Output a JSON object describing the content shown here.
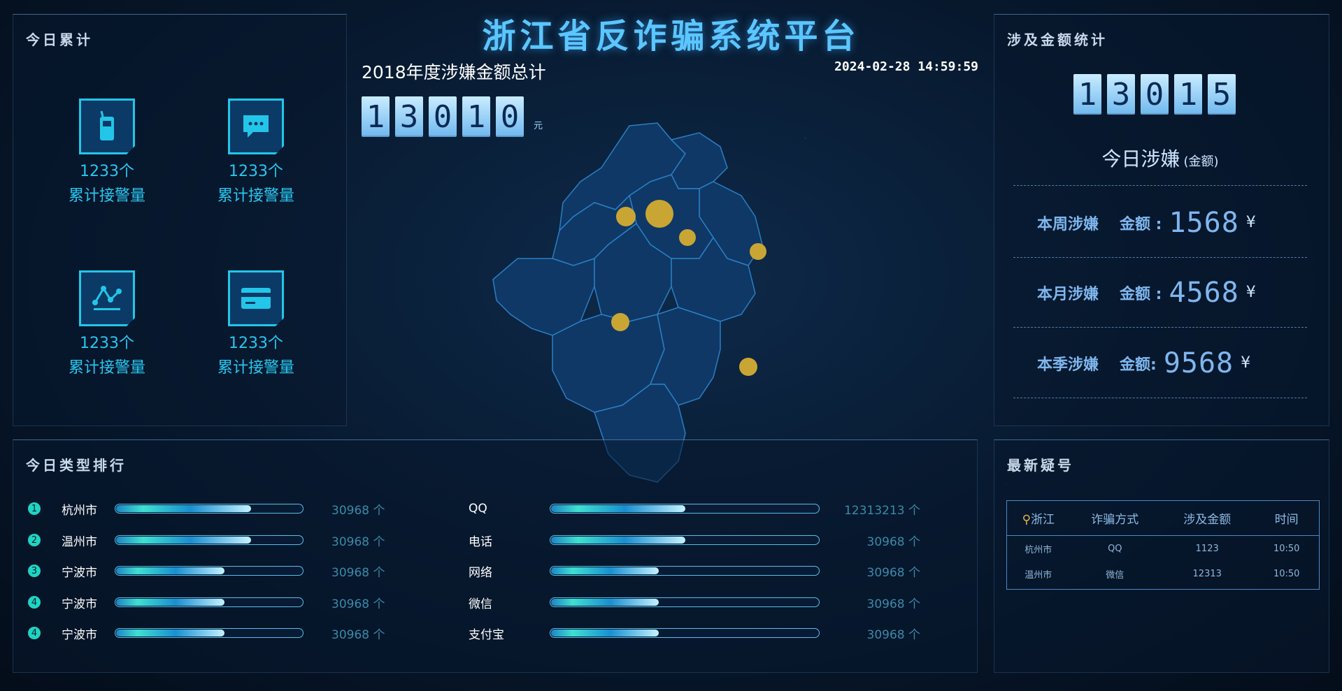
{
  "header": {
    "title": "浙江省反诈骗系统平台",
    "year_total_label": "2018年度涉嫌金额总计",
    "datetime": "2024-02-28 14:59:59",
    "year_digits": [
      "1",
      "3",
      "0",
      "1",
      "0"
    ],
    "year_unit": "元"
  },
  "left_panel": {
    "title": "今日累计",
    "stats": [
      {
        "icon": "phone-icon",
        "count": "1233个",
        "label": "累计接警量"
      },
      {
        "icon": "chat-icon",
        "count": "1233个",
        "label": "累计接警量"
      },
      {
        "icon": "network-icon",
        "count": "1233个",
        "label": "累计接警量"
      },
      {
        "icon": "card-icon",
        "count": "1233个",
        "label": "累计接警量"
      }
    ]
  },
  "right_panel": {
    "title": "涉及金额统计",
    "digits": [
      "1",
      "3",
      "0",
      "1",
      "5"
    ],
    "today_label": "今日涉嫌",
    "today_sub": "(金额)",
    "rows": [
      {
        "label": "本周涉嫌",
        "amount_label": "金额 :",
        "value": "1568",
        "currency": "¥"
      },
      {
        "label": "本月涉嫌",
        "amount_label": "金额 :",
        "value": "4568",
        "currency": "¥"
      },
      {
        "label": "本季涉嫌",
        "amount_label": "金额:",
        "value": "9568",
        "currency": "¥"
      }
    ]
  },
  "ranking": {
    "title": "今日类型排行",
    "cities": [
      {
        "rank": "1",
        "name": "杭州市",
        "value": "30968 个",
        "fill": 0.72
      },
      {
        "rank": "2",
        "name": "温州市",
        "value": "30968 个",
        "fill": 0.72
      },
      {
        "rank": "3",
        "name": "宁波市",
        "value": "30968 个",
        "fill": 0.58
      },
      {
        "rank": "4",
        "name": "宁波市",
        "value": "30968 个",
        "fill": 0.58
      },
      {
        "rank": "4",
        "name": "宁波市",
        "value": "30968 个",
        "fill": 0.58
      }
    ],
    "types": [
      {
        "name": "QQ",
        "value": "12313213 个",
        "fill": 0.5
      },
      {
        "name": "电话",
        "value": "30968 个",
        "fill": 0.5
      },
      {
        "name": "网络",
        "value": "30968 个",
        "fill": 0.4
      },
      {
        "name": "微信",
        "value": "30968 个",
        "fill": 0.4
      },
      {
        "name": "支付宝",
        "value": "30968 个",
        "fill": 0.4
      }
    ]
  },
  "latest": {
    "title": "最新疑号",
    "headers": [
      "浙江",
      "诈骗方式",
      "涉及金额",
      "时间"
    ],
    "rows": [
      [
        "杭州市",
        "QQ",
        "1123",
        "10:50"
      ],
      [
        "温州市",
        "微信",
        "12313",
        "10:50"
      ]
    ]
  },
  "colors": {
    "accent": "#5bc6ff",
    "cyan": "#29c6ef",
    "dot": "#c9a634",
    "map_fill": "#0f3866"
  }
}
